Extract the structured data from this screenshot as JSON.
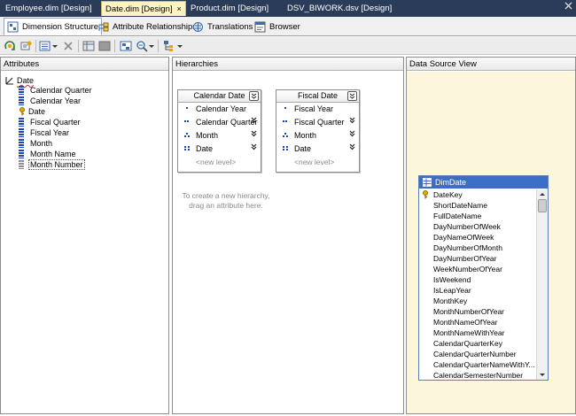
{
  "document_tabs": [
    {
      "label": "Employee.dim [Design]",
      "active": false
    },
    {
      "label": "Date.dim [Design]",
      "active": true
    },
    {
      "label": "Product.dim [Design]",
      "active": false
    },
    {
      "label": "DSV_BIWORK.dsv [Design]",
      "active": false
    }
  ],
  "tab_close_glyph": "×",
  "designer_tabs": [
    {
      "label": "Dimension Structure",
      "icon": "dimension-structure-icon",
      "active": true
    },
    {
      "label": "Attribute Relationships",
      "icon": "attribute-relationships-icon",
      "active": false
    },
    {
      "label": "Translations",
      "icon": "translations-icon",
      "active": false
    },
    {
      "label": "Browser",
      "icon": "browser-icon",
      "active": false
    }
  ],
  "panes": {
    "attributes": {
      "title": "Attributes"
    },
    "hierarchies": {
      "title": "Hierarchies"
    },
    "dsv": {
      "title": "Data Source View"
    }
  },
  "attributes": {
    "dimension": "Date",
    "items": [
      {
        "label": "Calendar Quarter",
        "icon": "attribute-icon"
      },
      {
        "label": "Calendar Year",
        "icon": "attribute-icon"
      },
      {
        "label": "Date",
        "icon": "key-attribute-icon"
      },
      {
        "label": "Fiscal Quarter",
        "icon": "attribute-icon"
      },
      {
        "label": "Fiscal Year",
        "icon": "attribute-icon"
      },
      {
        "label": "Month",
        "icon": "attribute-icon"
      },
      {
        "label": "Month Name",
        "icon": "attribute-icon"
      },
      {
        "label": "Month Number",
        "icon": "attribute-icon",
        "selected": true
      }
    ]
  },
  "hierarchies": [
    {
      "title": "Calendar Date",
      "levels": [
        {
          "label": "Calendar Year"
        },
        {
          "label": "Calendar Quarter"
        },
        {
          "label": "Month"
        },
        {
          "label": "Date"
        }
      ],
      "new_level": "<new level>"
    },
    {
      "title": "Fiscal Date",
      "levels": [
        {
          "label": "Fiscal Year"
        },
        {
          "label": "Fiscal Quarter"
        },
        {
          "label": "Month"
        },
        {
          "label": "Date"
        }
      ],
      "new_level": "<new level>"
    }
  ],
  "hierarchy_hint": "To create a new hierarchy, drag an attribute here.",
  "dsv_table": {
    "name": "DimDate",
    "columns": [
      {
        "name": "DateKey",
        "key": true
      },
      {
        "name": "ShortDateName"
      },
      {
        "name": "FullDateName"
      },
      {
        "name": "DayNumberOfWeek"
      },
      {
        "name": "DayNameOfWeek"
      },
      {
        "name": "DayNumberOfMonth"
      },
      {
        "name": "DayNumberOfYear"
      },
      {
        "name": "WeekNumberOfYear"
      },
      {
        "name": "IsWeekend"
      },
      {
        "name": "IsLeapYear"
      },
      {
        "name": "MonthKey"
      },
      {
        "name": "MonthNumberOfYear"
      },
      {
        "name": "MonthNameOfYear"
      },
      {
        "name": "MonthNameWithYear"
      },
      {
        "name": "CalendarQuarterKey"
      },
      {
        "name": "CalendarQuarterNumber"
      },
      {
        "name": "CalendarQuarterNameWithY..."
      },
      {
        "name": "CalendarSemesterNumber"
      }
    ]
  },
  "colors": {
    "tab_strip": "#2b3c59",
    "active_tab": "#fdf3c4",
    "dsv_background": "#fcf7dc",
    "table_header": "#3c6ec8",
    "attribute_icon": "#1c46b4",
    "key_icon": "#e0a800"
  }
}
